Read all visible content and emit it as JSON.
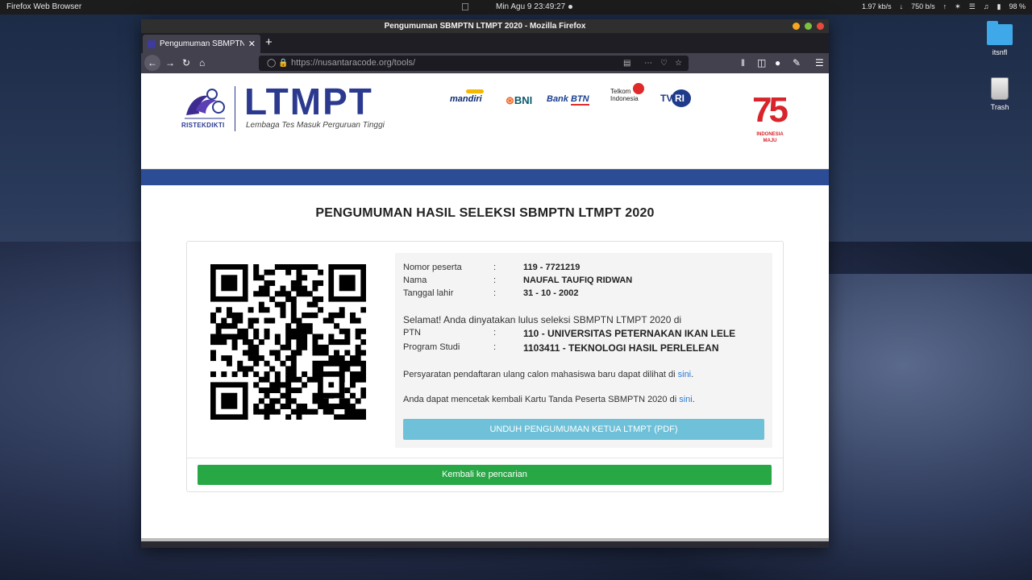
{
  "top_panel": {
    "app_name": "Firefox Web Browser",
    "clock": "Min Agu 9  23:49:27",
    "net_down": "1.97",
    "net_down_unit": "kb/s",
    "net_up": "750",
    "net_up_unit": "b/s",
    "battery": "98 %"
  },
  "desktop": {
    "folder_label": "itsnfl",
    "trash_label": "Trash"
  },
  "window": {
    "title": "Pengumuman SBMPTN LTMPT 2020 - Mozilla Firefox",
    "tab_title": "Pengumuman SBMPTN LTM",
    "url": "https://nusantaracode.org/tools/"
  },
  "header": {
    "ristek_text": "RISTEKDIKTI",
    "logo_word": "LTMPT",
    "logo_sub": "Lembaga Tes Masuk Perguruan Tinggi",
    "sponsors": {
      "mandiri": "mandiri",
      "bni": "BNI",
      "btn_bank": "Bank",
      "btn": "BTN",
      "telkom": "Telkom",
      "telkom_sub": "Indonesia",
      "tvri_t": "TV",
      "tvri_ri": "RI"
    },
    "ri75_num": "75",
    "ri75_line1": "INDONESIA",
    "ri75_line2": "MAJU"
  },
  "main": {
    "title": "PENGUMUMAN HASIL SELEKSI SBMPTN LTMPT 2020",
    "separator": ":",
    "fields": {
      "nomor_label": "Nomor peserta",
      "nomor_value": "119 - 7721219",
      "nama_label": "Nama",
      "nama_value": "NAUFAL TAUFIQ RIDWAN",
      "tgl_label": "Tanggal lahir",
      "tgl_value": "31 - 10 - 2002",
      "ptn_label": "PTN",
      "ptn_value": "110 - UNIVERSITAS PETERNAKAN IKAN LELE",
      "prodi_label": "Program Studi",
      "prodi_value": "1103411 - TEKNOLOGI HASIL PERLELEAN"
    },
    "congrats": "Selamat! Anda dinyatakan lulus seleksi SBMPTN LTMPT 2020 di",
    "note1": "Persyaratan pendaftaran ulang calon mahasiswa baru dapat dilihat di",
    "note2": "Anda dapat mencetak kembali Kartu Tanda Peserta SBMPTN 2020 di",
    "link_text": "sini",
    "period": ".",
    "download_label": "UNDUH PENGUMUMAN KETUA LTMPT (PDF)",
    "back_label": "Kembali ke pencarian"
  },
  "colors": {
    "brand_blue": "#2c4d95",
    "download_btn": "#6ec1d8",
    "back_btn": "#28a745",
    "link": "#2d7bd4"
  }
}
